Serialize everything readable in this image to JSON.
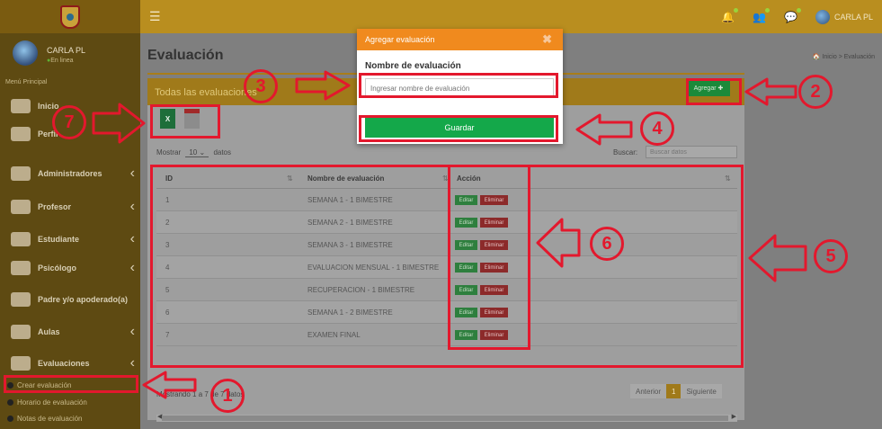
{
  "header": {
    "menu_icon": "hamburger-icon",
    "user_name": "CARLA PL",
    "icons": [
      "bell-icon",
      "users-icon",
      "chat-icon"
    ]
  },
  "sidebar": {
    "user_name": "CARLA PL",
    "status": "En linea",
    "menu_title": "Menú Principal",
    "items": [
      {
        "label": "Inicio",
        "icon": "home-icon"
      },
      {
        "label": "Perfil",
        "icon": "user-icon"
      },
      {
        "label": "Administradores",
        "icon": "admins-icon"
      },
      {
        "label": "Profesor",
        "icon": "teacher-icon"
      },
      {
        "label": "Estudiante",
        "icon": "student-icon"
      },
      {
        "label": "Psicólogo",
        "icon": "psychologist-icon"
      },
      {
        "label": "Padre y/o apoderado(a)",
        "icon": "parents-icon"
      },
      {
        "label": "Aulas",
        "icon": "classroom-icon"
      },
      {
        "label": "Evaluaciones",
        "icon": "evaluations-icon"
      }
    ],
    "subitems": [
      {
        "label": "Crear evaluación"
      },
      {
        "label": "Horario de evaluación"
      },
      {
        "label": "Notas de evaluación"
      }
    ]
  },
  "page": {
    "title": "Evaluación",
    "breadcrumb_home": "Inicio",
    "breadcrumb_sep": ">",
    "breadcrumb_current": "Evaluación"
  },
  "box": {
    "title": "Todas las evaluaciones",
    "add_button": "Agregar ✚",
    "show_label": "Mostrar",
    "show_value": "10",
    "show_suffix": "datos",
    "search_label": "Buscar:",
    "search_placeholder": "Buscar datos"
  },
  "table": {
    "headers": [
      "ID",
      "Nombre de evaluación",
      "Acción"
    ],
    "edit_label": "Editar",
    "delete_label": "Eliminar",
    "rows": [
      {
        "id": "1",
        "name": "SEMANA 1 - 1 BIMESTRE"
      },
      {
        "id": "2",
        "name": "SEMANA 2 - 1 BIMESTRE"
      },
      {
        "id": "3",
        "name": "SEMANA 3 - 1 BIMESTRE"
      },
      {
        "id": "4",
        "name": "EVALUACION MENSUAL - 1 BIMESTRE"
      },
      {
        "id": "5",
        "name": "RECUPERACION - 1 BIMESTRE"
      },
      {
        "id": "6",
        "name": "SEMANA 1 - 2 BIMESTRE"
      },
      {
        "id": "7",
        "name": "EXAMEN FINAL"
      }
    ],
    "info": "Mostrando 1 a 7 de 7 datos",
    "prev": "Anterior",
    "page": "1",
    "next": "Siguiente"
  },
  "modal": {
    "title": "Agregar evaluación",
    "close": "✖",
    "label": "Nombre de evaluación",
    "placeholder": "Ingresar nombre de evaluación",
    "save": "Guardar"
  },
  "annotations": {
    "color": "#e3182d",
    "numbers": [
      "1",
      "2",
      "3",
      "4",
      "5",
      "6",
      "7"
    ]
  }
}
